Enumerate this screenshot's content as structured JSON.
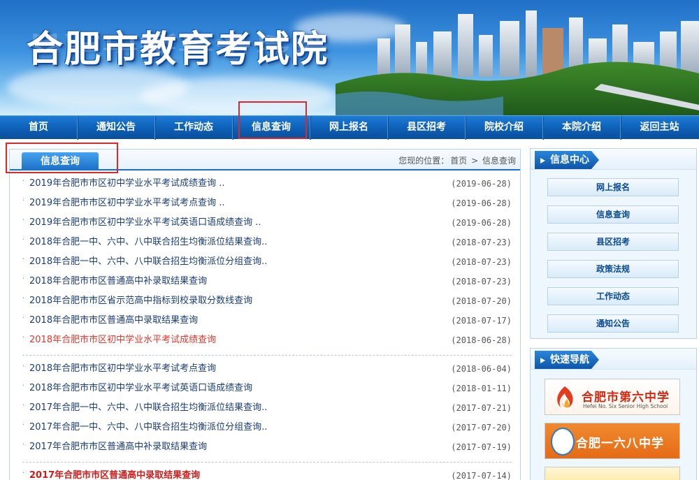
{
  "site": {
    "title": "合肥市教育考试院"
  },
  "nav": {
    "items": [
      "首页",
      "通知公告",
      "工作动态",
      "信息查询",
      "网上报名",
      "县区招考",
      "院校介绍",
      "本院介绍",
      "返回主站"
    ],
    "active": "信息查询"
  },
  "main": {
    "tab": "信息查询",
    "breadcrumb": {
      "prefix": "您现的位置：",
      "home": "首页",
      "sep": ">",
      "current": "信息查询"
    },
    "items_group1": [
      {
        "title": "2019年合肥市市区初中学业水平考试成绩查询 ..",
        "date": "(2019-06-28)"
      },
      {
        "title": "2019年合肥市市区初中学业水平考试考点查询 ..",
        "date": "(2019-06-28)"
      },
      {
        "title": "2019年合肥市市区初中学业水平考试英语口语成绩查询 ..",
        "date": "(2019-06-28)"
      },
      {
        "title": "2018年合肥一中、六中、八中联合招生均衡派位结果查询..",
        "date": "(2018-07-23)"
      },
      {
        "title": "2018年合肥一中、六中、八中联合招生均衡派位分组查询..",
        "date": "(2018-07-23)"
      },
      {
        "title": "2018年合肥市市区普通高中补录取结果查询",
        "date": "(2018-07-23)"
      },
      {
        "title": "2018年合肥市市区省示范高中指标到校录取分数线查询",
        "date": "(2018-07-20)"
      },
      {
        "title": "2018年合肥市市区普通高中录取结果查询",
        "date": "(2018-07-17)"
      },
      {
        "title": "2018年合肥市市区初中学业水平考试成绩查询",
        "date": "(2018-06-28)"
      }
    ],
    "items_group2": [
      {
        "title": "2018年合肥市市区初中学业水平考试考点查询",
        "date": "(2018-06-04)"
      },
      {
        "title": "2018年合肥市市区初中学业水平考试英语口语成绩查询",
        "date": "(2018-01-11)"
      },
      {
        "title": "2017年合肥一中、六中、八中联合招生均衡派位结果查询..",
        "date": "(2017-07-21)"
      },
      {
        "title": "2017年合肥一中、六中、八中联合招生均衡派位分组查询..",
        "date": "(2017-07-20)"
      },
      {
        "title": "2017年合肥市市区普通高中补录取结果查询",
        "date": "(2017-07-19)"
      }
    ],
    "items_group3": [
      {
        "title": "2017年合肥市市区普通高中录取结果查询",
        "date": "(2017-07-14)"
      }
    ]
  },
  "sidebar": {
    "info_center": {
      "title": "信息中心",
      "links": [
        "网上报名",
        "信息查询",
        "县区招考",
        "政策法规",
        "工作动态",
        "通知公告"
      ]
    },
    "quick_nav": {
      "title": "快速导航",
      "logos": [
        {
          "name": "合肥市第六中学",
          "en": "Hefei No. Six Senior High School"
        },
        {
          "name": "合肥一六八中学"
        }
      ]
    }
  },
  "colors": {
    "nav_blue": "#0d5fb6",
    "link_blue": "#1a3d7a",
    "highlight_red": "#e0282a",
    "item_red": "#e0382f"
  }
}
